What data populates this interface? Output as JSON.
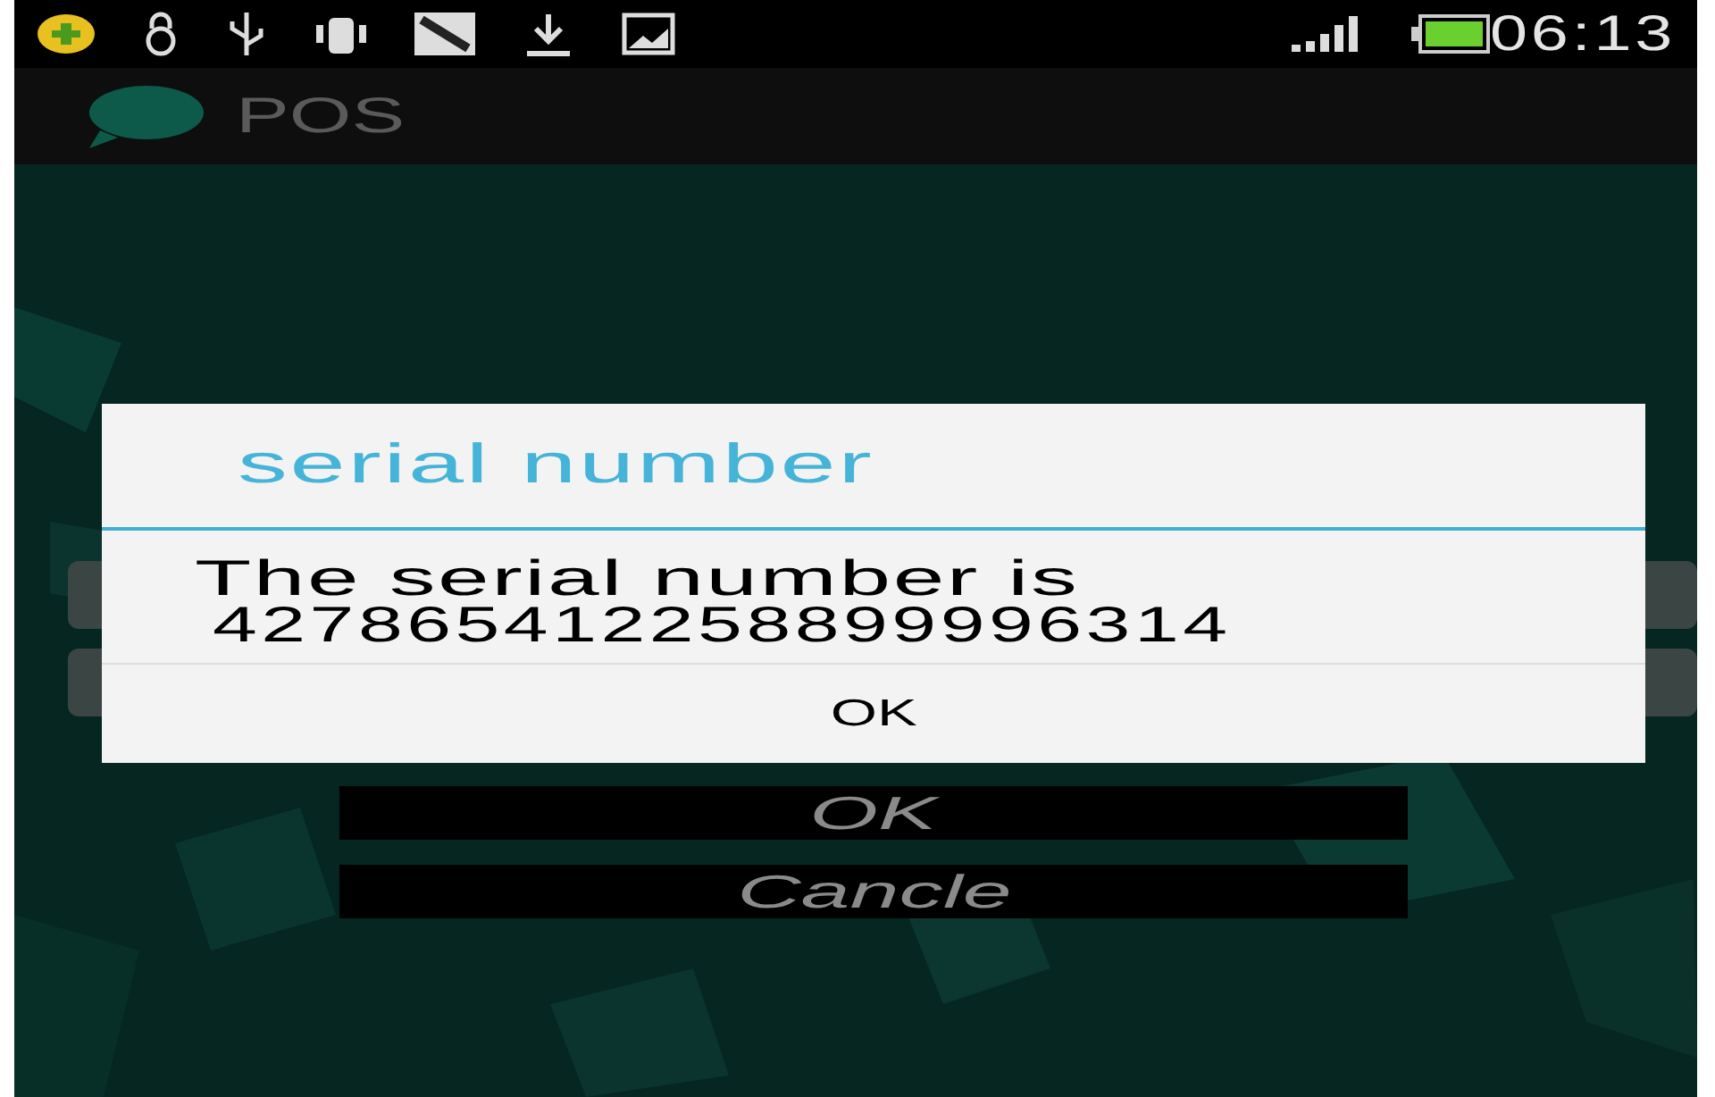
{
  "status_bar": {
    "time": "06:13"
  },
  "action_bar": {
    "title": "POS"
  },
  "buttons": [
    {
      "label": "OK"
    },
    {
      "label": "Cancle"
    }
  ],
  "dialog": {
    "title": "serial number",
    "message": "The serial number is",
    "serial": "427865412258899996314",
    "button": "OK"
  }
}
